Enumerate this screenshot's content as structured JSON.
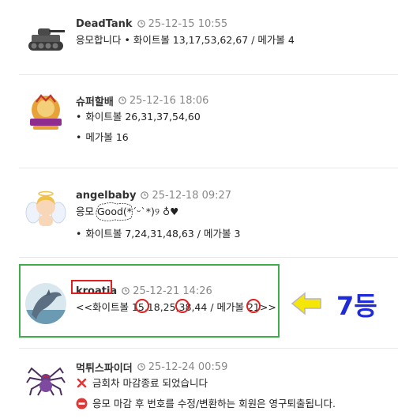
{
  "comments": [
    {
      "nickname": "DeadTank",
      "date": "25-12-15 10:55",
      "avatar_icon": "tank-icon",
      "line1": "응모합니다 • 화이트볼 13,17,53,62,67 / 메가볼 4"
    },
    {
      "nickname": "슈퍼할배",
      "date": "25-12-16 18:06",
      "avatar_icon": "olympus-logo-icon",
      "line1": "화이트볼 26,31,37,54,60",
      "line2": "메가볼 16"
    },
    {
      "nickname": "angelbaby",
      "date": "25-12-18 09:27",
      "avatar_icon": "angel-icon",
      "line1_prefix": "응모 ",
      "line1_good": "Good",
      "line1_suffix": "(*´ᵕ`*)୨ ♁♥",
      "line2": "화이트볼 7,24,31,48,63 / 메가볼 3"
    },
    {
      "nickname": "kroatia",
      "date": "25-12-21 14:26",
      "avatar_icon": "dolphin-icon",
      "line1": "<<화이트볼 15,18,25,38,44 / 메가볼 21>>"
    },
    {
      "nickname": "먹튀스파이더",
      "date": "25-12-24 00:59",
      "avatar_icon": "spider-icon",
      "line1": "금회차 마감종료 되었습니다",
      "line2": "응모 마감 후 번호를 수정/변환하는 회원은 영구퇴출됩니다."
    }
  ],
  "annotation": {
    "rank_label": "7등",
    "highlight_color": "#3cae4c",
    "circle_color": "#e02020",
    "arrow_color": "#f5e60a",
    "rank_color": "#1e2bd6"
  }
}
